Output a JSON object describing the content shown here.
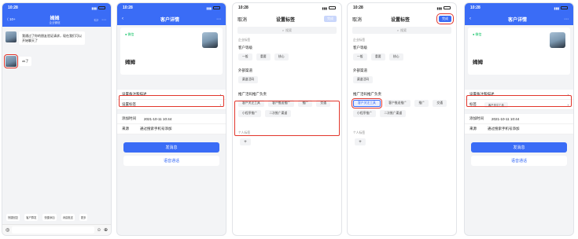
{
  "status": {
    "time": "10:28",
    "battery": "88"
  },
  "screen1": {
    "back_label": "⟨ 10+",
    "contact_name": "姆姆",
    "contact_sub": "企业微信",
    "msg1": "我通过了你的朋友验证请求，现在我们可以开始聊天了",
    "msg2": "ok了",
    "tools": [
      "快捷回复",
      "客户群发",
      "快捷添加",
      "消息推送",
      "更多"
    ]
  },
  "screen2": {
    "title": "客户详情",
    "wechat_tag": "微信",
    "name": "姆姆",
    "rows": [
      {
        "label": "设置备注和描述",
        "value": ""
      },
      {
        "label": "设置标签",
        "value": ""
      },
      {
        "label": "添加时间",
        "value": "2021-10-11 10:44"
      },
      {
        "label": "来源",
        "value": "通过搜索手机号添加"
      }
    ],
    "btn_primary": "发消息",
    "btn_secondary": "语音通话"
  },
  "screen3": {
    "cancel": "取消",
    "title": "设置标签",
    "done": "完成",
    "search": "搜索",
    "section_enterprise": "企业标签",
    "group1": "客户等级",
    "group1_tags": [
      "一般",
      "重要",
      "核心"
    ],
    "group2": "外部渠道",
    "group2_tags": [
      "渠道活码"
    ],
    "group3": "推广活码推广负责",
    "group3_tags": [
      "客户关注工具",
      "客户推送推广",
      "推广",
      "交通",
      "小程序推广",
      "二次推广渠道"
    ],
    "section_personal": "个人标签",
    "add": "+"
  },
  "screen4": {
    "cancel": "取消",
    "title": "设置标签",
    "done": "完成",
    "search": "搜索",
    "section_enterprise": "企业标签",
    "group1": "客户等级",
    "group1_tags": [
      "一般",
      "重要",
      "核心"
    ],
    "group2": "外部渠道",
    "group2_tags": [
      "渠道活码"
    ],
    "group3": "推广活码推广负责",
    "group3_tags": [
      "客户关注工具",
      "客户推送推广",
      "推广",
      "交通",
      "小程序推广",
      "二次推广渠道"
    ],
    "section_personal": "个人标签",
    "add": "+"
  },
  "screen5": {
    "title": "客户详情",
    "wechat_tag": "微信",
    "name": "姆姆",
    "rows": [
      {
        "label": "设置备注和描述",
        "value": ""
      },
      {
        "label": "标签",
        "value": "客户关注工具"
      },
      {
        "label": "添加时间",
        "value": "2021-10-11 10:44"
      },
      {
        "label": "来源",
        "value": "通过搜索手机号添加"
      }
    ],
    "btn_primary": "发消息",
    "btn_secondary": "语音通话"
  }
}
